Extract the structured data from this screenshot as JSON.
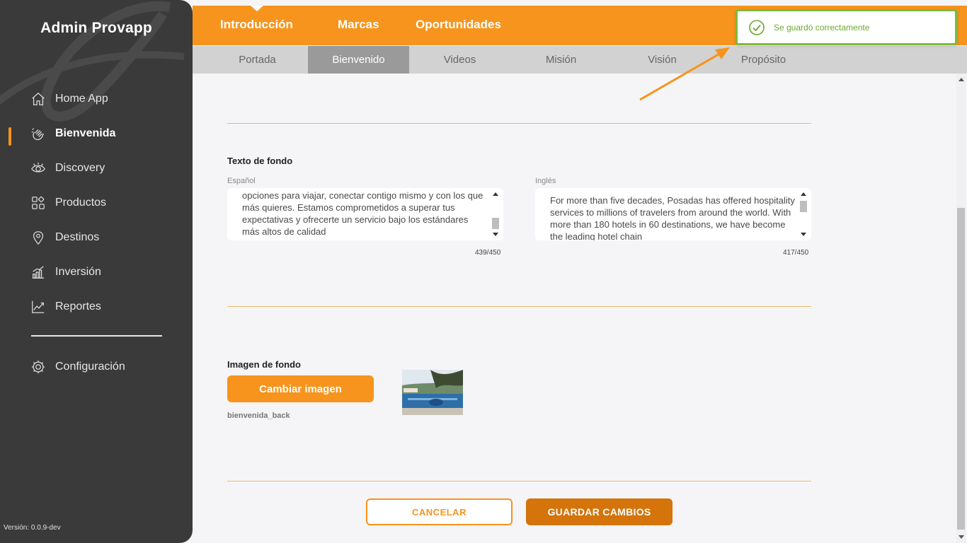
{
  "sidebar": {
    "brand": "Admin Provapp",
    "items": [
      {
        "label": "Home App",
        "icon": "home-icon"
      },
      {
        "label": "Bienvenida",
        "icon": "waving-hand-icon",
        "active": true
      },
      {
        "label": "Discovery",
        "icon": "eye-icon"
      },
      {
        "label": "Productos",
        "icon": "grid-icon"
      },
      {
        "label": "Destinos",
        "icon": "location-pin-icon"
      },
      {
        "label": "Inversión",
        "icon": "bar-chart-icon"
      },
      {
        "label": "Reportes",
        "icon": "line-chart-icon"
      }
    ],
    "config": {
      "label": "Configuración",
      "icon": "gear-icon"
    },
    "version": "Versión: 0.0.9-dev"
  },
  "topnav": {
    "tabs": [
      {
        "label": "Introducción",
        "active": true
      },
      {
        "label": "Marcas"
      },
      {
        "label": "Oportunidades"
      }
    ]
  },
  "subnav": {
    "tabs": [
      {
        "label": "Portada"
      },
      {
        "label": "Bienvenido",
        "active": true
      },
      {
        "label": "Videos"
      },
      {
        "label": "Misión"
      },
      {
        "label": "Visión"
      },
      {
        "label": "Propósito"
      }
    ]
  },
  "toast": {
    "message": "Se guardó correctamente",
    "icon": "check-circle-icon"
  },
  "background_text": {
    "title": "Texto de fondo",
    "spanish": {
      "label": "Español",
      "value": "opciones para viajar, conectar contigo mismo y con los que más quieres. Estamos comprometidos a superar tus expectativas y ofrecerte un servicio bajo los estándares más altos de calidad",
      "counter": "439/450"
    },
    "english": {
      "label": "Inglés",
      "value": "For more than five decades, Posadas has offered hospitality services to millions of travelers from around the world. With more than 180 hotels in 60 destinations, we have become the leading hotel chain",
      "counter": "417/450"
    }
  },
  "background_image": {
    "title": "Imagen de fondo",
    "button": "Cambiar imagen",
    "filename": "bienvenida_back"
  },
  "actions": {
    "cancel": "CANCELAR",
    "save": "GUARDAR CAMBIOS"
  },
  "colors": {
    "accent": "#f7941d",
    "sidebar": "#3a3a3a",
    "success": "#7dba3c",
    "save": "#d4740b"
  }
}
